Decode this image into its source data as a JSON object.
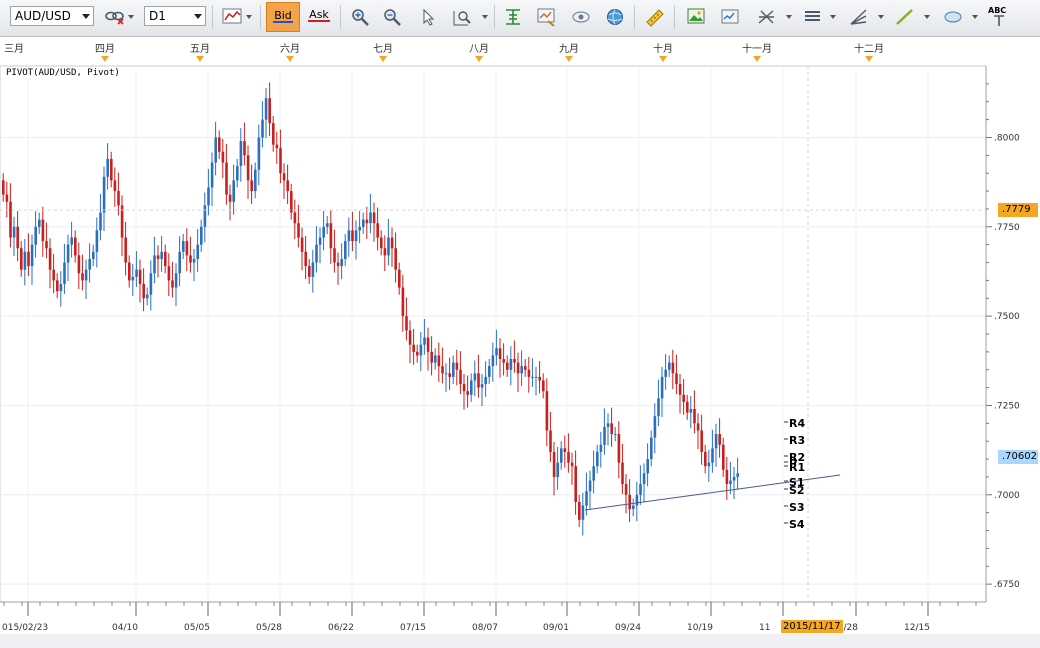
{
  "toolbar": {
    "symbol": "AUD/USD",
    "timeframe": "D1",
    "bid_label": "Bid",
    "ask_label": "Ask",
    "abc_label": "ABC"
  },
  "months": [
    "三月",
    "四月",
    "五月",
    "六月",
    "七月",
    "八月",
    "九月",
    "十月",
    "十一月",
    "十二月"
  ],
  "indicator_label": "PIVOT(AUD/USD, Pivot)",
  "price_axis": {
    "ticks": [
      ".8000",
      ".7750",
      ".7500",
      ".7250",
      ".7000",
      ".6750"
    ]
  },
  "date_axis": {
    "ticks": [
      "015/02/23",
      "04/10",
      "05/05",
      "05/28",
      "06/22",
      "07/15",
      "08/07",
      "09/01",
      "09/24",
      "10/19",
      "11",
      "11/28",
      "12/15"
    ]
  },
  "current_price_tags": {
    "upper": ".7779",
    "lower": ".70602"
  },
  "cursor_date": "2015/11/17",
  "pivot_levels": [
    {
      "name": "R4",
      "value": 0.7171
    },
    {
      "name": "R3",
      "value": 0.7146
    },
    {
      "name": "R2",
      "value": 0.7097
    },
    {
      "name": "P",
      "value": 0.7072
    },
    {
      "name": "R1",
      "value": 0.706
    },
    {
      "name": "S1",
      "value": 0.7018
    },
    {
      "name": "S2",
      "value": 0.6988
    },
    {
      "name": "S3",
      "value": 0.6931
    },
    {
      "name": "S4",
      "value": 0.6908
    }
  ],
  "colors": {
    "up": "#2a6fc0",
    "down": "#c8201e",
    "trendline": "#4b5a8a",
    "accent": "#f5a623",
    "lower_tag": "#a8d8ff"
  },
  "chart_data": {
    "type": "candlestick",
    "title": "",
    "instrument": "AUD/USD",
    "timeframe": "D1",
    "ylim": [
      0.67,
      0.82
    ],
    "y_ticks": [
      0.8,
      0.775,
      0.75,
      0.725,
      0.7,
      0.675
    ],
    "x_ticks": [
      "2015/02/23",
      "2015/04/10",
      "2015/05/05",
      "2015/05/28",
      "2015/06/22",
      "2015/07/15",
      "2015/08/07",
      "2015/09/01",
      "2015/09/24",
      "2015/10/19",
      "2015/11",
      "2015/11/28",
      "2015/12/15"
    ],
    "closes": [
      0.784,
      0.782,
      0.772,
      0.775,
      0.769,
      0.763,
      0.768,
      0.764,
      0.77,
      0.775,
      0.777,
      0.771,
      0.769,
      0.763,
      0.76,
      0.757,
      0.759,
      0.765,
      0.77,
      0.772,
      0.767,
      0.762,
      0.76,
      0.763,
      0.766,
      0.768,
      0.774,
      0.779,
      0.789,
      0.794,
      0.788,
      0.785,
      0.781,
      0.772,
      0.765,
      0.76,
      0.761,
      0.763,
      0.759,
      0.755,
      0.756,
      0.762,
      0.767,
      0.766,
      0.768,
      0.764,
      0.76,
      0.758,
      0.762,
      0.768,
      0.771,
      0.767,
      0.765,
      0.766,
      0.77,
      0.775,
      0.781,
      0.786,
      0.793,
      0.8,
      0.796,
      0.793,
      0.784,
      0.782,
      0.788,
      0.792,
      0.799,
      0.795,
      0.788,
      0.785,
      0.791,
      0.8,
      0.805,
      0.811,
      0.804,
      0.798,
      0.797,
      0.79,
      0.788,
      0.785,
      0.779,
      0.776,
      0.772,
      0.768,
      0.764,
      0.761,
      0.765,
      0.77,
      0.772,
      0.775,
      0.776,
      0.769,
      0.765,
      0.764,
      0.766,
      0.771,
      0.774,
      0.771,
      0.774,
      0.775,
      0.777,
      0.776,
      0.779,
      0.776,
      0.772,
      0.769,
      0.767,
      0.772,
      0.769,
      0.763,
      0.758,
      0.75,
      0.746,
      0.742,
      0.74,
      0.739,
      0.742,
      0.744,
      0.74,
      0.737,
      0.739,
      0.736,
      0.734,
      0.734,
      0.733,
      0.737,
      0.735,
      0.731,
      0.729,
      0.728,
      0.732,
      0.734,
      0.73,
      0.731,
      0.733,
      0.736,
      0.739,
      0.741,
      0.738,
      0.737,
      0.735,
      0.738,
      0.737,
      0.734,
      0.736,
      0.735,
      0.733,
      0.733,
      0.733,
      0.732,
      0.729,
      0.718,
      0.712,
      0.705,
      0.709,
      0.713,
      0.712,
      0.709,
      0.708,
      0.698,
      0.693,
      0.697,
      0.701,
      0.704,
      0.708,
      0.712,
      0.714,
      0.719,
      0.72,
      0.717,
      0.717,
      0.709,
      0.703,
      0.7,
      0.696,
      0.697,
      0.7,
      0.703,
      0.706,
      0.71,
      0.716,
      0.722,
      0.727,
      0.733,
      0.735,
      0.737,
      0.734,
      0.731,
      0.728,
      0.726,
      0.723,
      0.724,
      0.72,
      0.718,
      0.712,
      0.708,
      0.709,
      0.713,
      0.717,
      0.714,
      0.707,
      0.703,
      0.704,
      0.705,
      0.706
    ]
  }
}
